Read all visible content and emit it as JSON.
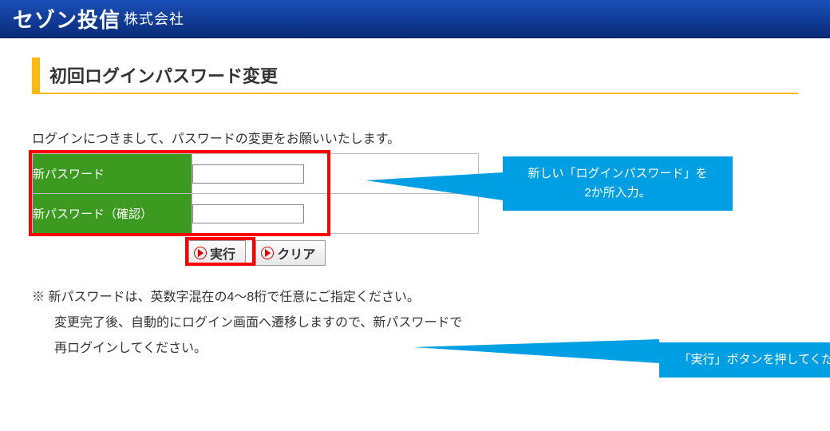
{
  "header": {
    "logo_main": "セゾン投信",
    "logo_suffix": "株式会社"
  },
  "page": {
    "title": "初回ログインパスワード変更",
    "intro": "ログインにつきまして、パスワードの変更をお願いいたします。"
  },
  "form": {
    "rows": [
      {
        "label": "新パスワード"
      },
      {
        "label": "新パスワード（確認）"
      }
    ]
  },
  "buttons": {
    "execute": "実行",
    "clear": "クリア"
  },
  "callouts": {
    "c1_line1": "新しい「ログインパスワード」を",
    "c1_line2": "2か所入力。",
    "c2": "「実行」ボタンを押してください。"
  },
  "notes": {
    "n1": "※ 新パスワードは、英数字混在の4～8桁で任意にご指定ください。",
    "n2": "変更完了後、自動的にログイン画面へ遷移しますので、新パスワードで",
    "n3": "再ログインしてください。"
  }
}
